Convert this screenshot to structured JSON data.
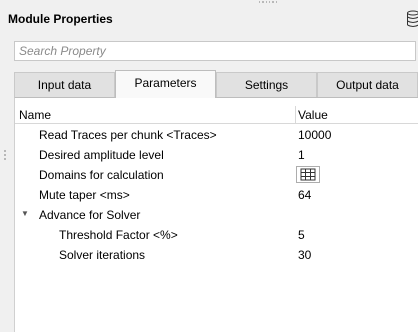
{
  "panel": {
    "title": "Module Properties",
    "db_icon": "database-icon"
  },
  "search": {
    "placeholder": "Search Property",
    "value": ""
  },
  "tabs": [
    {
      "label": "Input data",
      "active": false
    },
    {
      "label": "Parameters",
      "active": true
    },
    {
      "label": "Settings",
      "active": false
    },
    {
      "label": "Output data",
      "active": false
    }
  ],
  "table": {
    "headers": {
      "name": "Name",
      "value": "Value"
    },
    "rows": [
      {
        "name": "Read Traces per chunk <Traces>",
        "value": "10000"
      },
      {
        "name": "Desired amplitude level",
        "value": "1"
      },
      {
        "name": "Domains for calculation",
        "value": "",
        "control": "grid-icon"
      },
      {
        "name": "Mute taper <ms>",
        "value": "64"
      },
      {
        "name": "Advance for Solver",
        "value": "",
        "expanded": true
      },
      {
        "name": "Threshold Factor <%>",
        "value": "5"
      },
      {
        "name": "Solver iterations",
        "value": "30"
      }
    ]
  },
  "colors": {
    "background": "#f0f0f0",
    "active_tab": "#f9f9f9",
    "inactive_tab": "#e1e1e1"
  }
}
